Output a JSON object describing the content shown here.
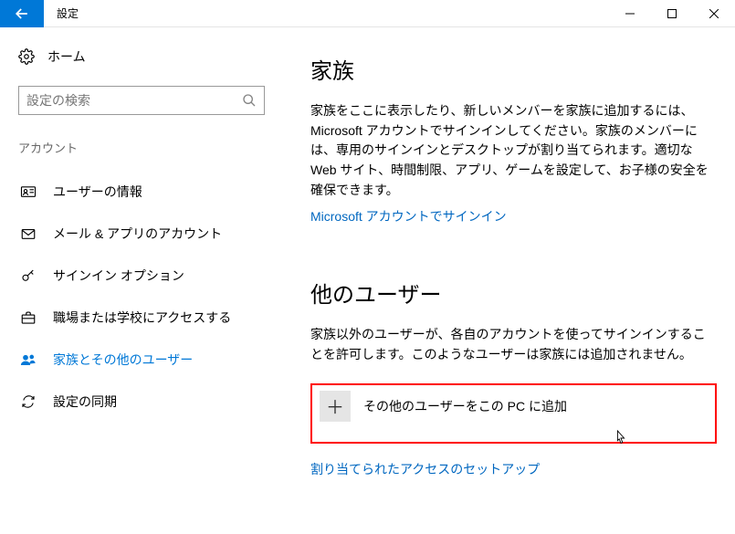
{
  "titlebar": {
    "title": "設定"
  },
  "sidebar": {
    "home_label": "ホーム",
    "search_placeholder": "設定の検索",
    "section_label": "アカウント",
    "items": [
      {
        "label": "ユーザーの情報"
      },
      {
        "label": "メール & アプリのアカウント"
      },
      {
        "label": "サインイン オプション"
      },
      {
        "label": "職場または学校にアクセスする"
      },
      {
        "label": "家族とその他のユーザー"
      },
      {
        "label": "設定の同期"
      }
    ]
  },
  "content": {
    "family": {
      "heading": "家族",
      "desc": "家族をここに表示したり、新しいメンバーを家族に追加するには、Microsoft アカウントでサインインしてください。家族のメンバーには、専用のサインインとデスクトップが割り当てられます。適切な Web サイト、時間制限、アプリ、ゲームを設定して、お子様の安全を確保できます。",
      "signin_link": "Microsoft アカウントでサインイン"
    },
    "others": {
      "heading": "他のユーザー",
      "desc": "家族以外のユーザーが、各自のアカウントを使ってサインインすることを許可します。このようなユーザーは家族には追加されません。",
      "add_label": "その他のユーザーをこの PC に追加",
      "setup_link": "割り当てられたアクセスのセットアップ"
    }
  }
}
